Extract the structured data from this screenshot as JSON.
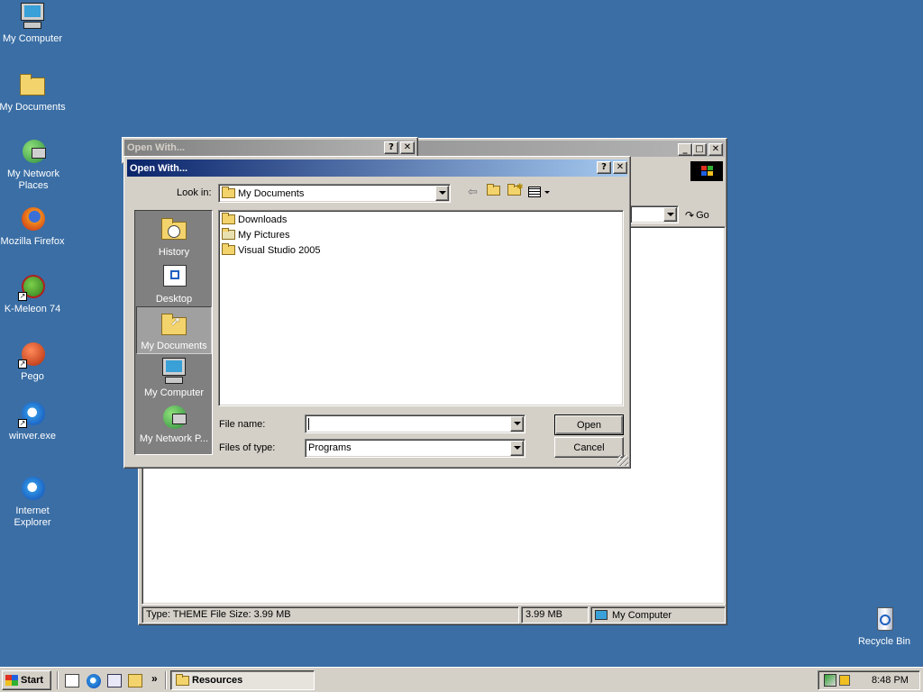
{
  "desktop": {
    "icons": [
      {
        "label": "My Computer"
      },
      {
        "label": "My Documents"
      },
      {
        "label": "My Network Places"
      },
      {
        "label": "Mozilla Firefox"
      },
      {
        "label": "K-Meleon 74"
      },
      {
        "label": "Pego"
      },
      {
        "label": "winver.exe"
      },
      {
        "label": "Internet Explorer"
      },
      {
        "label": "Recycle Bin"
      }
    ]
  },
  "explorer_window": {
    "go_label": "Go",
    "status": {
      "info": "Type: THEME File Size: 3.99 MB",
      "size": "3.99 MB",
      "zone": "My Computer"
    }
  },
  "inactive_dialog": {
    "title": "Open With..."
  },
  "open_dialog": {
    "title": "Open With...",
    "look_in_label": "Look in:",
    "look_in_value": "My Documents",
    "places": [
      {
        "label": "History"
      },
      {
        "label": "Desktop"
      },
      {
        "label": "My Documents"
      },
      {
        "label": "My Computer"
      },
      {
        "label": "My Network P..."
      }
    ],
    "files": [
      {
        "name": "Downloads"
      },
      {
        "name": "My Pictures"
      },
      {
        "name": "Visual Studio 2005"
      }
    ],
    "file_name_label": "File name:",
    "file_name_value": "",
    "files_of_type_label": "Files of type:",
    "files_of_type_value": "Programs",
    "open_label": "Open",
    "cancel_label": "Cancel",
    "help_glyph": "?",
    "close_glyph": "✕"
  },
  "taskbar": {
    "start_label": "Start",
    "task_label": "Resources",
    "clock": "8:48 PM",
    "chevron": "»"
  },
  "colors": {
    "desktop": "#3a6ea5",
    "title_active": "#0a246a",
    "face": "#d4d0c8"
  }
}
